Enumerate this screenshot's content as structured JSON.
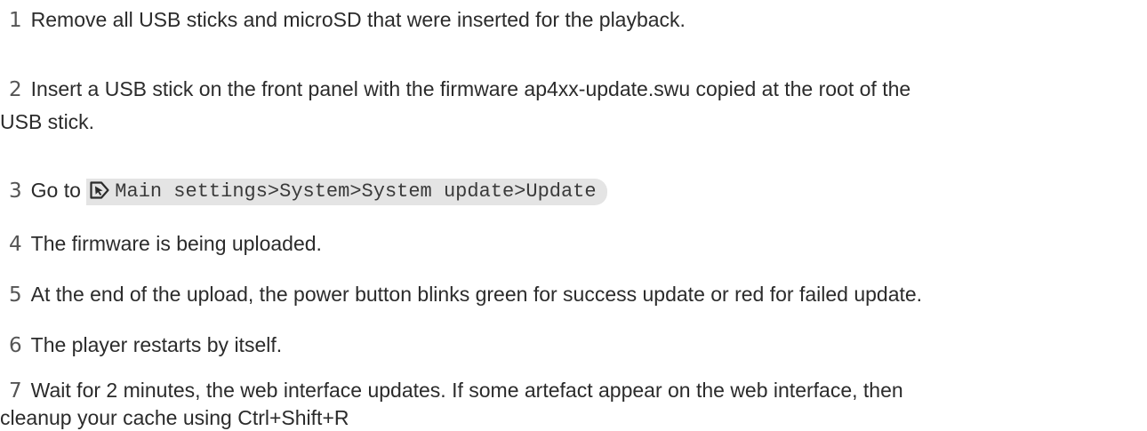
{
  "steps": [
    {
      "num": "1",
      "text": "Remove all USB sticks and microSD that were inserted for the playback."
    },
    {
      "num": "2",
      "text": "Insert a USB stick on the front panel with the firmware ap4xx-update.swu copied at the root of the",
      "text2": "USB stick."
    },
    {
      "num": "3",
      "text": "Go to",
      "path": "Main settings>System>System update>Update",
      "icon": "remote-pointer-icon"
    },
    {
      "num": "4",
      "text": "The firmware is being uploaded."
    },
    {
      "num": "5",
      "text": "At the end of the upload, the power button blinks green for success update or red for failed update."
    },
    {
      "num": "6",
      "text": "The player restarts by itself."
    },
    {
      "num": "7",
      "text": "Wait for 2 minutes, the web interface updates. If some artefact appear on the web interface, then",
      "text2": "cleanup your cache using Ctrl+Shift+R"
    }
  ]
}
